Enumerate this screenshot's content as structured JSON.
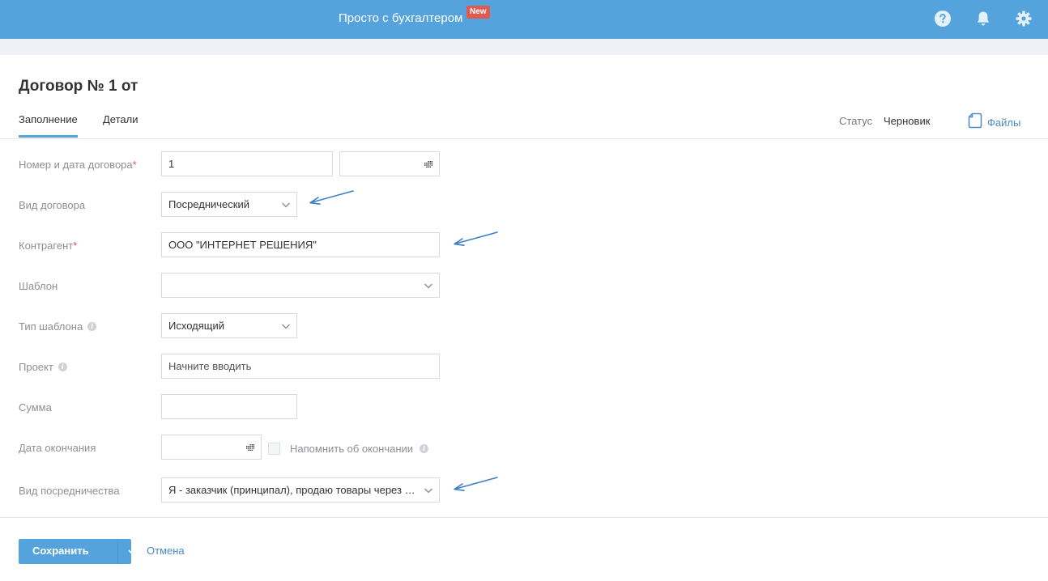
{
  "topbar": {
    "promo_text": "Просто с бухгалтером",
    "badge": "New",
    "icons": [
      "help-icon",
      "bell-icon",
      "gear-icon"
    ],
    "color": "#55a3dd"
  },
  "document": {
    "title": "Договор № 1 от"
  },
  "tabs": [
    {
      "label": "Заполнение",
      "active": true
    },
    {
      "label": "Детали",
      "active": false
    }
  ],
  "status": {
    "label": "Статус",
    "value": "Черновик"
  },
  "files": {
    "label": "Файлы"
  },
  "form": {
    "number_date": {
      "label": "Номер и дата договора",
      "required": "*",
      "number": "1",
      "date": ""
    },
    "contract_type": {
      "label": "Вид договора",
      "value": "Посреднический"
    },
    "counterparty": {
      "label": "Контрагент",
      "required": "*",
      "value": "ООО \"ИНТЕРНЕТ РЕШЕНИЯ\""
    },
    "template": {
      "label": "Шаблон",
      "value": ""
    },
    "template_type": {
      "label": "Тип шаблона",
      "value": "Исходящий"
    },
    "project": {
      "label": "Проект",
      "placeholder": "Начните вводить"
    },
    "amount": {
      "label": "Сумма",
      "value": ""
    },
    "end_date": {
      "label": "Дата окончания",
      "value": "",
      "remind_label": "Напомнить об окончании"
    },
    "mediation_type": {
      "label": "Вид посредничества",
      "value": "Я - заказчик (принципал), продаю товары через посредника"
    }
  },
  "footer": {
    "save_label": "Сохранить",
    "cancel_label": "Отмена"
  },
  "colors": {
    "accent": "#55a3dd",
    "badge": "#e05a4f",
    "link": "#4a8ac8",
    "arrow": "#3d7fc4"
  }
}
